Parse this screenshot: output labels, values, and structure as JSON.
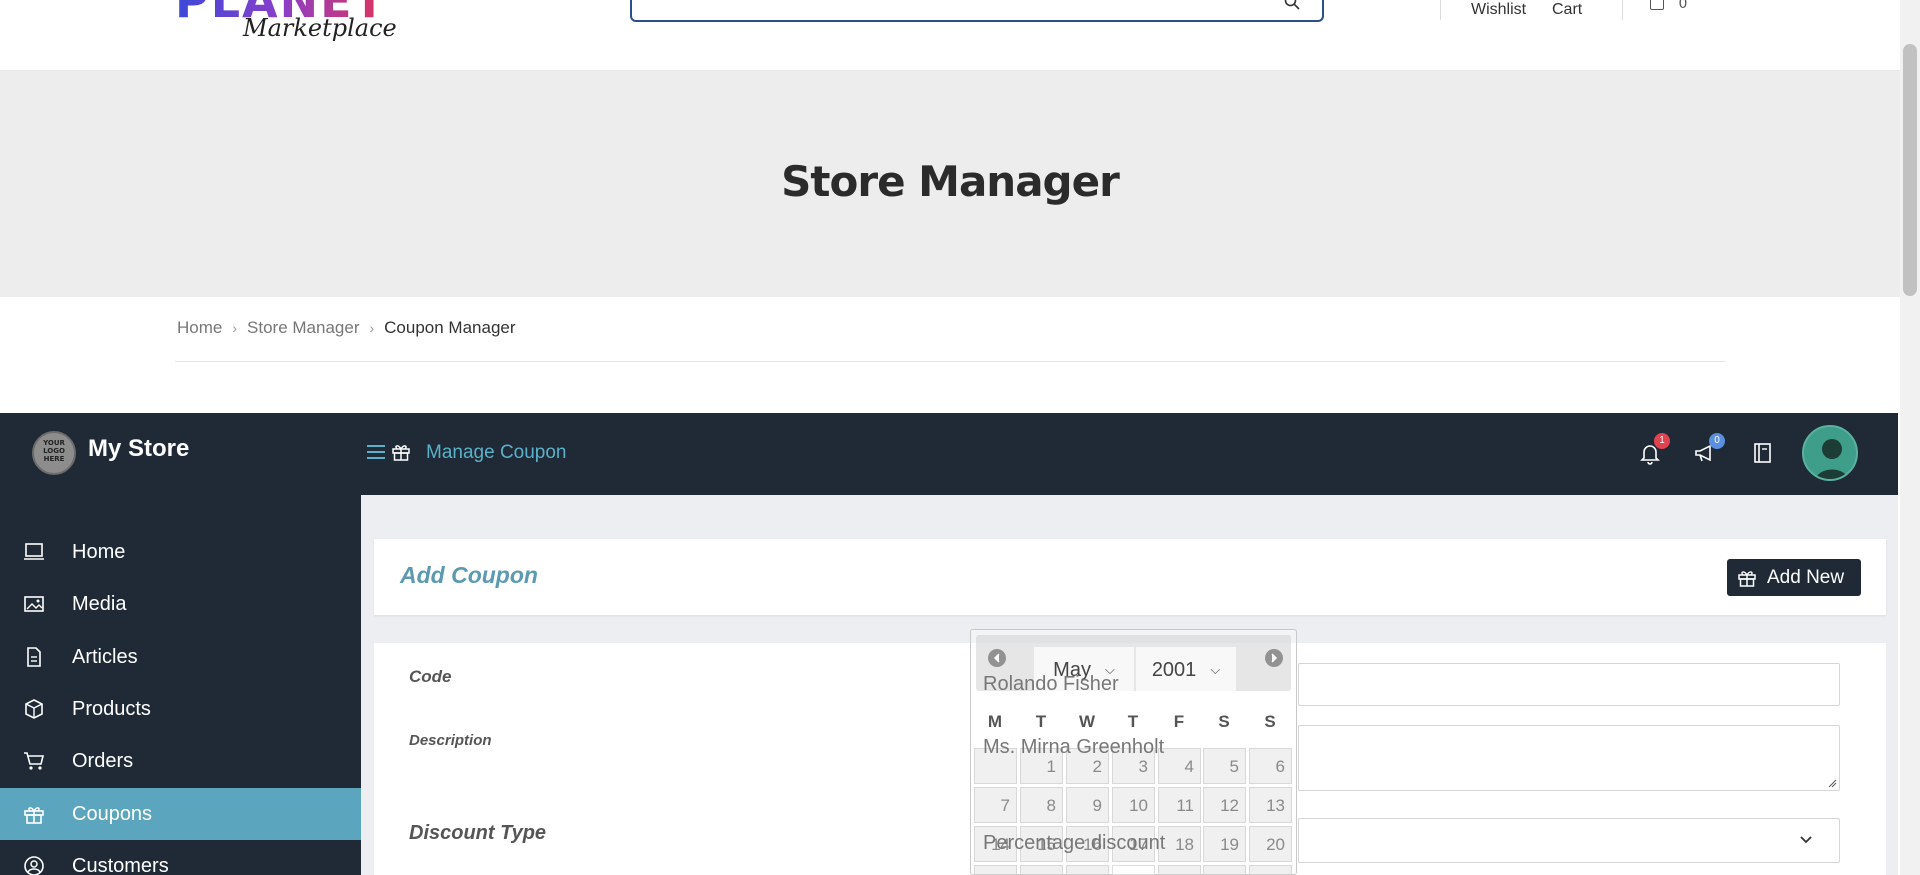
{
  "header": {
    "brand_text": "PLANET",
    "brand_sub": "Marketplace",
    "wishlist_label": "Wishlist",
    "cart_label": "Cart",
    "cart_count": "0"
  },
  "hero": {
    "title": "Store Manager"
  },
  "breadcrumb": [
    "Home",
    "Store Manager",
    "Coupon Manager"
  ],
  "store_bar": {
    "store_name": "My Store",
    "store_logo_text": "YOUR LOGO HERE",
    "page_title": "Manage Coupon",
    "notifications_count": "1",
    "announcements_count": "0"
  },
  "sidebar": {
    "items": [
      {
        "label": "Home",
        "icon": "monitor-icon"
      },
      {
        "label": "Media",
        "icon": "image-icon"
      },
      {
        "label": "Articles",
        "icon": "document-icon"
      },
      {
        "label": "Products",
        "icon": "box-icon"
      },
      {
        "label": "Orders",
        "icon": "cart-icon"
      },
      {
        "label": "Coupons",
        "icon": "gift-icon",
        "active": true
      },
      {
        "label": "Customers",
        "icon": "user-circle-icon"
      }
    ]
  },
  "form": {
    "title": "Add Coupon",
    "add_new_label": "Add New",
    "code_label": "Code",
    "description_label": "Description",
    "discount_type_label": "Discount Type",
    "discount_type_value": "Percentage discount"
  },
  "datepicker": {
    "month": "May",
    "year": "2001",
    "weekdays": [
      "M",
      "T",
      "W",
      "T",
      "F",
      "S",
      "S"
    ],
    "row1": [
      "",
      "1",
      "2",
      "3",
      "4",
      "5",
      "6"
    ],
    "row2": [
      "7",
      "8",
      "9",
      "10",
      "11",
      "12",
      "13"
    ],
    "row3": [
      "14",
      "15",
      "16",
      "17",
      "18",
      "19",
      "20"
    ],
    "autocomplete_1": "Rolando Fisher",
    "autocomplete_2": "Ms. Mirna Greenholt"
  },
  "colors": {
    "dark": "#1f2a36",
    "accent": "#5ba6be",
    "notif_badge": "#e0434f",
    "announce_badge": "#5b8fe0"
  }
}
